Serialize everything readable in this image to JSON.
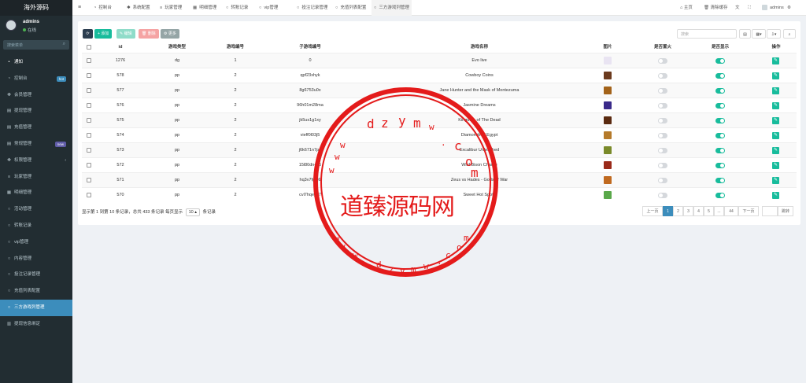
{
  "app_title": "海外源码",
  "user": {
    "name": "admins",
    "status": "在线"
  },
  "sidebar_search": {
    "placeholder": "搜索菜单"
  },
  "sidebar": {
    "items": [
      {
        "label": "通知",
        "icon": "•"
      },
      {
        "label": "控制台",
        "icon": "◔",
        "badge": "hot",
        "badge_color": "#3c8dbc"
      },
      {
        "label": "会员管理",
        "icon": "✤"
      },
      {
        "label": "提现管理",
        "icon": "▤"
      },
      {
        "label": "充值管理",
        "icon": "▤"
      },
      {
        "label": "常规管理",
        "icon": "▤",
        "badge": "new",
        "badge_color": "#605ca8"
      },
      {
        "label": "权限管理",
        "icon": "✤",
        "chevron": "‹"
      },
      {
        "label": "玩家管理",
        "icon": "≡"
      },
      {
        "label": "明细管理",
        "icon": "▦"
      },
      {
        "label": "活动管理",
        "icon": "○"
      },
      {
        "label": "转账记录",
        "icon": "○"
      },
      {
        "label": "vip管理",
        "icon": "○"
      },
      {
        "label": "内容管理",
        "icon": "○"
      },
      {
        "label": "投注记录管理",
        "icon": "○"
      },
      {
        "label": "充值列表配置",
        "icon": "○"
      },
      {
        "label": "三方游戏列管理",
        "icon": "○"
      },
      {
        "label": "提现信息绑定",
        "icon": "▥"
      }
    ]
  },
  "topbar": {
    "menu_icon": "≡",
    "tabs": [
      {
        "label": "控制台",
        "icon": "◔"
      },
      {
        "label": "系统配置",
        "icon": "✱"
      },
      {
        "label": "玩家管理",
        "icon": "≡"
      },
      {
        "label": "明细管理",
        "icon": "▦"
      },
      {
        "label": "转账记录",
        "icon": "○"
      },
      {
        "label": "vip管理",
        "icon": "○"
      },
      {
        "label": "投注记录管理",
        "icon": "○"
      },
      {
        "label": "充值列表配置",
        "icon": "○"
      },
      {
        "label": "三方游戏列管理",
        "icon": "○"
      }
    ],
    "home": "主页",
    "clear_cache": "清除缓存",
    "admin": "admins"
  },
  "toolbar": {
    "refresh_icon": "⟳",
    "add": "+ 添加",
    "edit": "✎ 编辑",
    "delete": "🗑 删除",
    "more": "⚙ 更多",
    "search_placeholder": "搜索",
    "colors": {
      "refresh": "#2c3e50",
      "add": "#18bc9c",
      "edit": "#8fdcc9",
      "delete": "#f5a3a3",
      "more": "#95a5a6"
    }
  },
  "table": {
    "headers": [
      "id",
      "游戏类型",
      "游戏编号",
      "子游戏编号",
      "游戏名称",
      "图片",
      "是否置火",
      "是否显示",
      "操作"
    ],
    "rows": [
      {
        "id": "1276",
        "type": "dg",
        "num": "1",
        "sub": "0",
        "name": "Evo live",
        "thumb": "#e9e4f2",
        "hot": false,
        "show": true
      },
      {
        "id": "578",
        "type": "pp",
        "num": "2",
        "sub": "qpf23xhyk",
        "name": "Cowboy Coins",
        "thumb": "#6b3a1e",
        "hot": false,
        "show": true
      },
      {
        "id": "577",
        "type": "pp",
        "num": "2",
        "sub": "8g6753u0x",
        "name": "Jane Hunter and the Mask of Montezuma",
        "thumb": "#a3631a",
        "hot": false,
        "show": true
      },
      {
        "id": "576",
        "type": "pp",
        "num": "2",
        "sub": "96h01m28ma",
        "name": "Jasmine Dreams",
        "thumb": "#3a2a8a",
        "hot": false,
        "show": true
      },
      {
        "id": "575",
        "type": "pp",
        "num": "2",
        "sub": "jk5us1g1xy",
        "name": "Kingdom of The Dead",
        "thumb": "#5a2a10",
        "hot": false,
        "show": true
      },
      {
        "id": "574",
        "type": "pp",
        "num": "2",
        "sub": "vieff0l03j5",
        "name": "Diamonds of Egypt",
        "thumb": "#b57a2a",
        "hot": false,
        "show": true
      },
      {
        "id": "573",
        "type": "pp",
        "num": "2",
        "sub": "j6k671n7pu",
        "name": "Excalibur Unleashed",
        "thumb": "#7a8a2a",
        "hot": false,
        "show": true
      },
      {
        "id": "572",
        "type": "pp",
        "num": "2",
        "sub": "15l80dn4c5",
        "name": "Wild Bison Charge",
        "thumb": "#9a2a1a",
        "hot": false,
        "show": true
      },
      {
        "id": "571",
        "type": "pp",
        "num": "2",
        "sub": "hq3v7fgjq6",
        "name": "Zeus vs Hades - Gods of War",
        "thumb": "#c06a20",
        "hot": false,
        "show": true
      },
      {
        "id": "570",
        "type": "pp",
        "num": "2",
        "sub": "cvl7hqeyg7",
        "name": "Sweet Hot Spotz",
        "thumb": "#5aa84a",
        "hot": false,
        "show": true
      }
    ]
  },
  "pagination": {
    "info_prefix": "显示第 1 到第 10 条记录，总共 433 条记录 每页显示",
    "page_size": "10 ▴",
    "info_suffix": "条记录",
    "prev": "上一页",
    "pages": [
      "1",
      "2",
      "3",
      "4",
      "5",
      "...",
      "44"
    ],
    "next": "下一页",
    "jump": "跳转"
  },
  "watermark": {
    "text": "道臻源码网",
    "top": "dzym",
    "bottom": "www.dzym.com",
    "color": "#e41b1b"
  }
}
